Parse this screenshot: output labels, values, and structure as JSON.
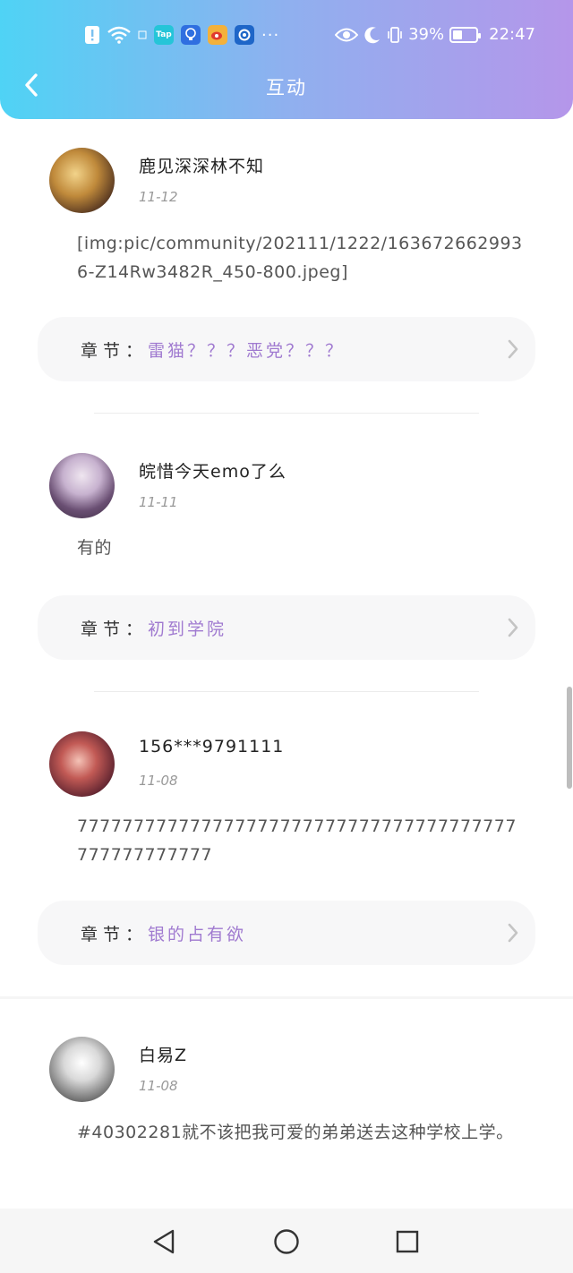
{
  "status_bar": {
    "time": "22:47",
    "battery": "39%",
    "app_icons": [
      "alert-icon",
      "wifi-icon",
      "tap-app-icon",
      "bulb-app-icon",
      "weibo-app-icon",
      "browser-app-icon",
      "more-dots-icon"
    ],
    "right_icons": [
      "eye-icon",
      "moon-icon",
      "vibrate-icon",
      "battery-icon"
    ],
    "tap_label": "Tap",
    "more": "···"
  },
  "header": {
    "title": "互动",
    "back_icon": "chevron-left-icon"
  },
  "comments": [
    {
      "username": "鹿见深深林不知",
      "date": "11-12",
      "content": "[img:pic/community/202111/1222/1636726629936-Z14Rw3482R_450-800.jpeg]",
      "chapter_label": "章节",
      "chapter_colon": "：",
      "chapter_value": "雷猫？？？恶党？？？"
    },
    {
      "username": "皖惜今天emo了么",
      "date": "11-11",
      "content": "有的",
      "chapter_label": "章节",
      "chapter_colon": "：",
      "chapter_value": "初到学院"
    },
    {
      "username": "156***9791111",
      "date": "11-08",
      "content": "777777777777777777777777777777777777777777777777777",
      "chapter_label": "章节",
      "chapter_colon": "：",
      "chapter_value": "银的占有欲"
    },
    {
      "username": "白易Z",
      "date": "11-08",
      "content": "#40302281就不该把我可爱的弟弟送去这种学校上学。"
    }
  ],
  "colors": {
    "header_gradient_start": "#4fd3f5",
    "header_gradient_end": "#b596ea",
    "chapter_accent": "#a07ad0"
  },
  "bottom_nav": {
    "icons": [
      "back-triangle-icon",
      "home-circle-icon",
      "recents-square-icon"
    ]
  }
}
